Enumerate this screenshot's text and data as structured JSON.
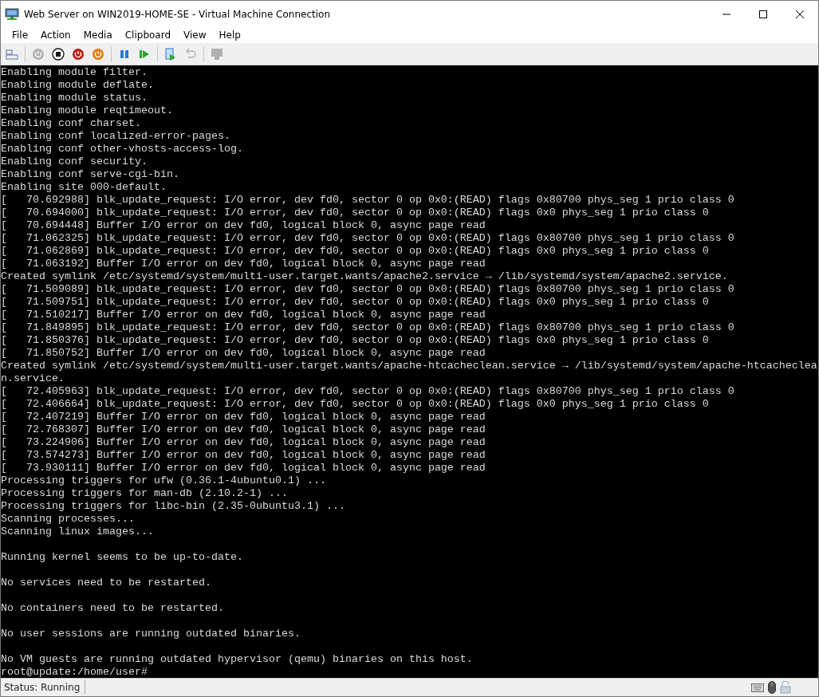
{
  "window": {
    "title": "Web Server on WIN2019-HOME-SE - Virtual Machine Connection"
  },
  "menu": [
    "File",
    "Action",
    "Media",
    "Clipboard",
    "View",
    "Help"
  ],
  "toolbar": [
    {
      "kind": "ctrl-alt-del",
      "disabled": false
    },
    {
      "kind": "separator"
    },
    {
      "kind": "start",
      "disabled": true
    },
    {
      "kind": "turn-off",
      "disabled": false
    },
    {
      "kind": "shut-down",
      "disabled": false
    },
    {
      "kind": "save",
      "disabled": false
    },
    {
      "kind": "separator"
    },
    {
      "kind": "pause",
      "disabled": false
    },
    {
      "kind": "reset",
      "disabled": false
    },
    {
      "kind": "separator"
    },
    {
      "kind": "checkpoint",
      "disabled": false
    },
    {
      "kind": "revert",
      "disabled": true
    },
    {
      "kind": "separator"
    },
    {
      "kind": "enhanced-session",
      "disabled": true
    }
  ],
  "console": {
    "lines": [
      {
        "kind": "text",
        "text": "Enabling module filter."
      },
      {
        "kind": "text",
        "text": "Enabling module deflate."
      },
      {
        "kind": "text",
        "text": "Enabling module status."
      },
      {
        "kind": "text",
        "text": "Enabling module reqtimeout."
      },
      {
        "kind": "text",
        "text": "Enabling conf charset."
      },
      {
        "kind": "text",
        "text": "Enabling conf localized-error-pages."
      },
      {
        "kind": "text",
        "text": "Enabling conf other-vhosts-access-log."
      },
      {
        "kind": "text",
        "text": "Enabling conf security."
      },
      {
        "kind": "text",
        "text": "Enabling conf serve-cgi-bin."
      },
      {
        "kind": "text",
        "text": "Enabling site 000-default."
      },
      {
        "kind": "text",
        "text": "[   70.692988] blk_update_request: I/O error, dev fd0, sector 0 op 0x0:(READ) flags 0x80700 phys_seg 1 prio class 0"
      },
      {
        "kind": "text",
        "text": "[   70.694000] blk_update_request: I/O error, dev fd0, sector 0 op 0x0:(READ) flags 0x0 phys_seg 1 prio class 0"
      },
      {
        "kind": "text",
        "text": "[   70.694448] Buffer I/O error on dev fd0, logical block 0, async page read"
      },
      {
        "kind": "text",
        "text": "[   71.062325] blk_update_request: I/O error, dev fd0, sector 0 op 0x0:(READ) flags 0x80700 phys_seg 1 prio class 0"
      },
      {
        "kind": "text",
        "text": "[   71.062869] blk_update_request: I/O error, dev fd0, sector 0 op 0x0:(READ) flags 0x0 phys_seg 1 prio class 0"
      },
      {
        "kind": "text",
        "text": "[   71.063192] Buffer I/O error on dev fd0, logical block 0, async page read"
      },
      {
        "kind": "text",
        "text": "Created symlink /etc/systemd/system/multi-user.target.wants/apache2.service → /lib/systemd/system/apache2.service."
      },
      {
        "kind": "text",
        "text": "[   71.509089] blk_update_request: I/O error, dev fd0, sector 0 op 0x0:(READ) flags 0x80700 phys_seg 1 prio class 0"
      },
      {
        "kind": "text",
        "text": "[   71.509751] blk_update_request: I/O error, dev fd0, sector 0 op 0x0:(READ) flags 0x0 phys_seg 1 prio class 0"
      },
      {
        "kind": "text",
        "text": "[   71.510217] Buffer I/O error on dev fd0, logical block 0, async page read"
      },
      {
        "kind": "text",
        "text": "[   71.849895] blk_update_request: I/O error, dev fd0, sector 0 op 0x0:(READ) flags 0x80700 phys_seg 1 prio class 0"
      },
      {
        "kind": "text",
        "text": "[   71.850376] blk_update_request: I/O error, dev fd0, sector 0 op 0x0:(READ) flags 0x0 phys_seg 1 prio class 0"
      },
      {
        "kind": "text",
        "text": "[   71.850752] Buffer I/O error on dev fd0, logical block 0, async page read"
      },
      {
        "kind": "text",
        "text": "Created symlink /etc/systemd/system/multi-user.target.wants/apache-htcacheclean.service → /lib/systemd/system/apache-htcacheclea"
      },
      {
        "kind": "text",
        "text": "n.service."
      },
      {
        "kind": "text",
        "text": "[   72.405963] blk_update_request: I/O error, dev fd0, sector 0 op 0x0:(READ) flags 0x80700 phys_seg 1 prio class 0"
      },
      {
        "kind": "text",
        "text": "[   72.406664] blk_update_request: I/O error, dev fd0, sector 0 op 0x0:(READ) flags 0x0 phys_seg 1 prio class 0"
      },
      {
        "kind": "text",
        "text": "[   72.407219] Buffer I/O error on dev fd0, logical block 0, async page read"
      },
      {
        "kind": "text",
        "text": "[   72.768307] Buffer I/O error on dev fd0, logical block 0, async page read"
      },
      {
        "kind": "text",
        "text": "[   73.224906] Buffer I/O error on dev fd0, logical block 0, async page read"
      },
      {
        "kind": "text",
        "text": "[   73.574273] Buffer I/O error on dev fd0, logical block 0, async page read"
      },
      {
        "kind": "text",
        "text": "[   73.930111] Buffer I/O error on dev fd0, logical block 0, async page read"
      },
      {
        "kind": "text",
        "text": "Processing triggers for ufw (0.36.1-4ubuntu0.1) ..."
      },
      {
        "kind": "text",
        "text": "Processing triggers for man-db (2.10.2-1) ..."
      },
      {
        "kind": "text",
        "text": "Processing triggers for libc-bin (2.35-0ubuntu3.1) ..."
      },
      {
        "kind": "text",
        "text": "Scanning processes..."
      },
      {
        "kind": "text",
        "text": "Scanning linux images..."
      },
      {
        "kind": "blank"
      },
      {
        "kind": "text",
        "text": "Running kernel seems to be up-to-date."
      },
      {
        "kind": "blank"
      },
      {
        "kind": "text",
        "text": "No services need to be restarted."
      },
      {
        "kind": "blank"
      },
      {
        "kind": "text",
        "text": "No containers need to be restarted."
      },
      {
        "kind": "blank"
      },
      {
        "kind": "text",
        "text": "No user sessions are running outdated binaries."
      },
      {
        "kind": "blank"
      },
      {
        "kind": "text",
        "text": "No VM guests are running outdated hypervisor (qemu) binaries on this host."
      },
      {
        "kind": "prompt",
        "text": "root@update:/home/user#"
      }
    ]
  },
  "status_bar": {
    "text": "Status: Running"
  }
}
